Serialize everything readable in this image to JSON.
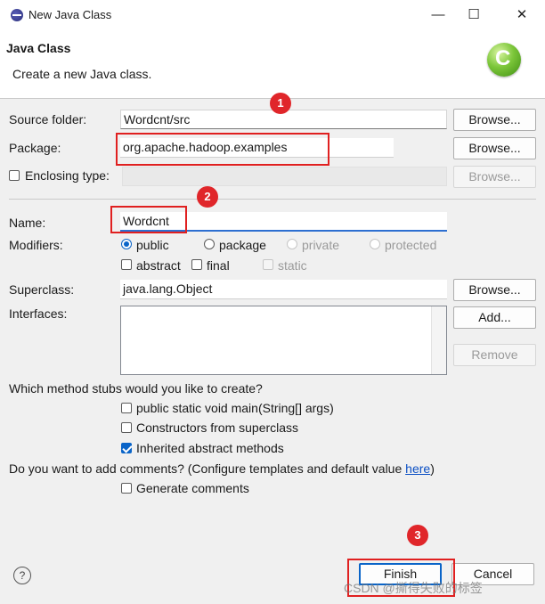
{
  "window": {
    "title": "New Java Class",
    "minimize_glyph": "—",
    "maximize_glyph": "☐",
    "close_glyph": "✕"
  },
  "header": {
    "title": "Java Class",
    "description": "Create a new Java class.",
    "logo_glyph": "C"
  },
  "form": {
    "source_folder": {
      "label": "Source folder:",
      "value": "Wordcnt/src",
      "browse": "Browse..."
    },
    "package": {
      "label": "Package:",
      "value": "org.apache.hadoop.examples",
      "browse": "Browse..."
    },
    "enclosing": {
      "label": "Enclosing type:",
      "value": "",
      "browse": "Browse..."
    },
    "name": {
      "label": "Name:",
      "value": "Wordcnt"
    },
    "modifiers": {
      "label": "Modifiers:",
      "public": "public",
      "package": "package",
      "private": "private",
      "protected": "protected",
      "abstract": "abstract",
      "final": "final",
      "static": "static"
    },
    "superclass": {
      "label": "Superclass:",
      "value": "java.lang.Object",
      "browse": "Browse..."
    },
    "interfaces": {
      "label": "Interfaces:",
      "add": "Add...",
      "remove": "Remove"
    },
    "stubs": {
      "question": "Which method stubs would you like to create?",
      "main": "public static void main(String[] args)",
      "constructors": "Constructors from superclass",
      "inherited": "Inherited abstract methods"
    },
    "comments": {
      "question": "Do you want to add comments? (Configure templates and default value ",
      "link": "here",
      "close_paren": ")",
      "generate": "Generate comments"
    }
  },
  "footer": {
    "help_glyph": "?",
    "finish": "Finish",
    "cancel": "Cancel"
  },
  "annotations": {
    "badge1": "1",
    "badge2": "2",
    "badge3": "3"
  },
  "watermark": "CSDN @撕得失败的标签",
  "colors": {
    "accent": "#0a64c8",
    "annotation_red": "#e02020",
    "link": "#0b4fc4"
  }
}
